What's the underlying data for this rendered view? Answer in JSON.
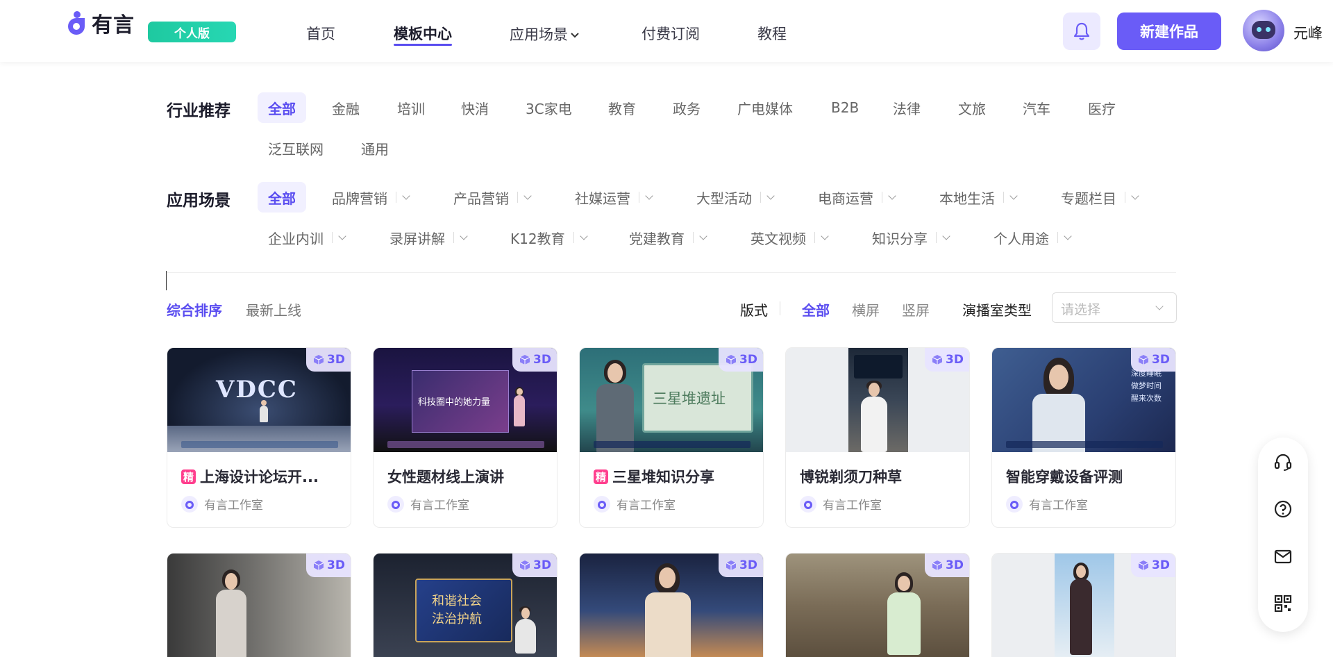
{
  "header": {
    "logo_text": "有言",
    "plan_badge": "个人版",
    "nav": [
      {
        "label": "首页"
      },
      {
        "label": "模板中心"
      },
      {
        "label": "应用场景"
      },
      {
        "label": "付费订阅"
      },
      {
        "label": "教程"
      }
    ],
    "new_button": "新建作品",
    "username": "元峰"
  },
  "filters": {
    "industry_label": "行业推荐",
    "industry": [
      "全部",
      "金融",
      "培训",
      "快消",
      "3C家电",
      "教育",
      "政务",
      "广电媒体",
      "B2B",
      "法律",
      "文旅",
      "汽车",
      "医疗",
      "泛互联网",
      "通用"
    ],
    "scene_label": "应用场景",
    "scene": [
      "全部",
      "品牌营销",
      "产品营销",
      "社媒运营",
      "大型活动",
      "电商运营",
      "本地生活",
      "专题栏目",
      "企业内训",
      "录屏讲解",
      "K12教育",
      "党建教育",
      "英文视频",
      "知识分享",
      "个人用途"
    ]
  },
  "sort": {
    "options": [
      "综合排序",
      "最新上线"
    ],
    "format_label": "版式",
    "formats": [
      "全部",
      "横屏",
      "竖屏"
    ],
    "studio_label": "演播室类型",
    "studio_placeholder": "请选择"
  },
  "cards": [
    {
      "title": "上海设计论坛开...",
      "author": "有言工作室",
      "badge": "3D",
      "featured": "精",
      "thumb_text": "VDCC"
    },
    {
      "title": "女性题材线上演讲",
      "author": "有言工作室",
      "badge": "3D",
      "thumb_text": "科技圈中的她力量"
    },
    {
      "title": "三星堆知识分享",
      "author": "有言工作室",
      "badge": "3D",
      "featured": "精",
      "thumb_text": "三星堆遗址"
    },
    {
      "title": "博锐剃须刀种草",
      "author": "有言工作室",
      "badge": "3D"
    },
    {
      "title": "智能穿戴设备评测",
      "author": "有言工作室",
      "badge": "3D",
      "thumb_lines": [
        "深度睡眠",
        "做梦时间",
        "醒来次数"
      ]
    },
    {
      "badge": "3D"
    },
    {
      "badge": "3D",
      "thumb_lines": [
        "和谐社会",
        "法治护航"
      ]
    },
    {
      "badge": "3D"
    },
    {
      "badge": "3D"
    },
    {
      "badge": "3D"
    }
  ],
  "colors": {
    "accent": "#5a4df0",
    "button": "#6a5cf7",
    "badge_green": "#1ec9a0",
    "featured_pink": "#ff3f8e"
  }
}
